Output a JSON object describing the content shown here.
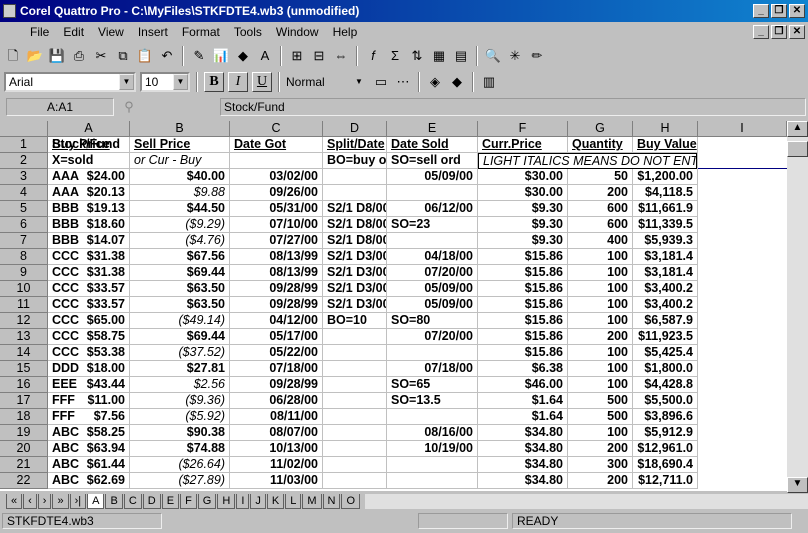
{
  "window": {
    "title": "Corel Quattro Pro - C:\\MyFiles\\STKFDTE4.wb3 (unmodified)"
  },
  "menu": [
    "File",
    "Edit",
    "View",
    "Insert",
    "Format",
    "Tools",
    "Window",
    "Help"
  ],
  "format": {
    "font": "Arial",
    "size": "10",
    "bold": "B",
    "italic": "I",
    "underline": "U",
    "style": "Normal"
  },
  "input_line": {
    "cell": "A:A1",
    "content": "Stock/Fund"
  },
  "columns": [
    "A",
    "B",
    "C",
    "D",
    "E",
    "F",
    "G",
    "H",
    "I"
  ],
  "rows": [
    [
      "1",
      "Stock/Fund",
      "",
      "Buy Price",
      "Sell Price",
      "Date Got",
      "Split/Date",
      "Date Sold",
      "Curr.Price",
      "Quantity",
      "Buy Value"
    ],
    [
      "2",
      "X=sold",
      "",
      "",
      "or Cur - Buy",
      "",
      "BO=buy ord",
      "SO=sell ord",
      "LIGHT ITALICS MEANS DO NOT ENTER",
      "",
      ""
    ],
    [
      "3",
      "AAA",
      "X",
      "$24.00",
      "$40.00",
      "03/02/00",
      "",
      "05/09/00",
      "$30.00",
      "50",
      "$1,200.00"
    ],
    [
      "4",
      "AAA",
      "",
      "$20.13",
      "$9.88",
      "09/26/00",
      "",
      "",
      "$30.00",
      "200",
      "$4,118.5"
    ],
    [
      "5",
      "BBB",
      "X",
      "$19.13",
      "$44.50",
      "05/31/00",
      "S2/1 D8/00",
      "06/12/00",
      "$9.30",
      "600",
      "$11,661.9"
    ],
    [
      "6",
      "BBB",
      "",
      "$18.60",
      "($9.29)",
      "07/10/00",
      "S2/1 D8/00",
      "SO=23",
      "$9.30",
      "600",
      "$11,339.5"
    ],
    [
      "7",
      "BBB",
      "",
      "$14.07",
      "($4.76)",
      "07/27/00",
      "S2/1 D8/00",
      "",
      "$9.30",
      "400",
      "$5,939.3"
    ],
    [
      "8",
      "CCC",
      "X",
      "$31.38",
      "$67.56",
      "08/13/99",
      "S2/1 D3/00",
      "04/18/00",
      "$15.86",
      "100",
      "$3,181.4"
    ],
    [
      "9",
      "CCC",
      "X",
      "$31.38",
      "$69.44",
      "08/13/99",
      "S2/1 D3/00",
      "07/20/00",
      "$15.86",
      "100",
      "$3,181.4"
    ],
    [
      "10",
      "CCC",
      "X",
      "$33.57",
      "$63.50",
      "09/28/99",
      "S2/1 D3/00",
      "05/09/00",
      "$15.86",
      "100",
      "$3,400.2"
    ],
    [
      "11",
      "CCC",
      "X",
      "$33.57",
      "$63.50",
      "09/28/99",
      "S2/1 D3/00",
      "05/09/00",
      "$15.86",
      "100",
      "$3,400.2"
    ],
    [
      "12",
      "CCC",
      "",
      "$65.00",
      "($49.14)",
      "04/12/00",
      "BO=10",
      "SO=80",
      "$15.86",
      "100",
      "$6,587.9"
    ],
    [
      "13",
      "CCC",
      "X",
      "$58.75",
      "$69.44",
      "05/17/00",
      "",
      "07/20/00",
      "$15.86",
      "200",
      "$11,923.5"
    ],
    [
      "14",
      "CCC",
      "",
      "$53.38",
      "($37.52)",
      "05/22/00",
      "",
      "",
      "$15.86",
      "100",
      "$5,425.4"
    ],
    [
      "15",
      "DDD",
      "X",
      "$18.00",
      "$27.81",
      "07/18/00",
      "",
      "07/18/00",
      "$6.38",
      "100",
      "$1,800.0"
    ],
    [
      "16",
      "EEE",
      "",
      "$43.44",
      "$2.56",
      "09/28/99",
      "",
      "SO=65",
      "$46.00",
      "100",
      "$4,428.8"
    ],
    [
      "17",
      "FFF",
      "",
      "$11.00",
      "($9.36)",
      "06/28/00",
      "",
      "SO=13.5",
      "$1.64",
      "500",
      "$5,500.0"
    ],
    [
      "18",
      "FFF",
      "",
      "$7.56",
      "($5.92)",
      "08/11/00",
      "",
      "",
      "$1.64",
      "500",
      "$3,896.6"
    ],
    [
      "19",
      "ABC",
      "X",
      "$58.25",
      "$90.38",
      "08/07/00",
      "",
      "08/16/00",
      "$34.80",
      "100",
      "$5,912.9"
    ],
    [
      "20",
      "ABC",
      "X",
      "$63.94",
      "$74.88",
      "10/13/00",
      "",
      "10/19/00",
      "$34.80",
      "200",
      "$12,961.0"
    ],
    [
      "21",
      "ABC",
      "",
      "$61.44",
      "($26.64)",
      "11/02/00",
      "",
      "",
      "$34.80",
      "300",
      "$18,690.4"
    ],
    [
      "22",
      "ABC",
      "",
      "$62.69",
      "($27.89)",
      "11/03/00",
      "",
      "",
      "$34.80",
      "200",
      "$12,711.0"
    ]
  ],
  "sheet_tabs": [
    "A",
    "B",
    "C",
    "D",
    "E",
    "F",
    "G",
    "H",
    "I",
    "J",
    "K",
    "L",
    "M",
    "N",
    "O"
  ],
  "status": {
    "file": "STKFDTE4.wb3",
    "mode": "READY"
  }
}
